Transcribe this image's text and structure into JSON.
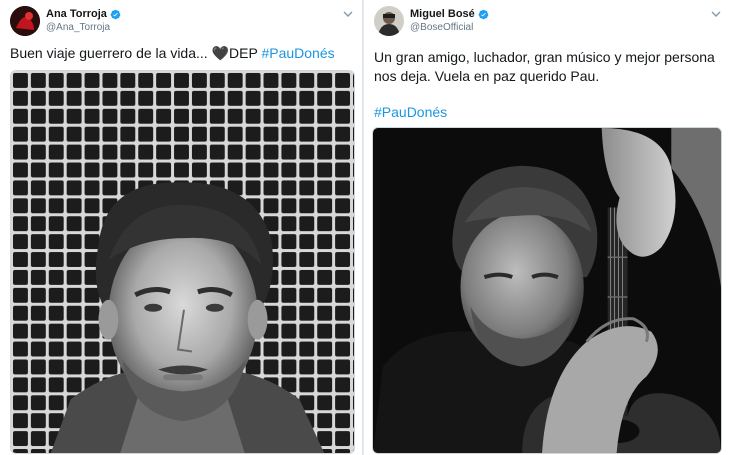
{
  "tweets": [
    {
      "display_name": "Ana Torroja",
      "handle": "@Ana_Torroja",
      "text_before": "Buen viaje guerrero de la vida... ",
      "heart": "🖤",
      "text_after": "DEP ",
      "hashtag": "#PauDonés",
      "avatar_icon": "avatar-red-icon",
      "media_icon": "portrait-photo-tiled-wall"
    },
    {
      "display_name": "Miguel Bosé",
      "handle": "@BoseOfficial",
      "text_line1": "Un gran amigo, luchador, gran músico y mejor persona",
      "text_line2": "nos deja. Vuela en paz querido Pau.",
      "hashtag": "#PauDonés",
      "avatar_icon": "avatar-photo-icon",
      "media_icon": "portrait-photo-guitar"
    }
  ],
  "colors": {
    "hashtag": "#1b95e0",
    "verified": "#1da1f2",
    "handle": "#657786"
  }
}
